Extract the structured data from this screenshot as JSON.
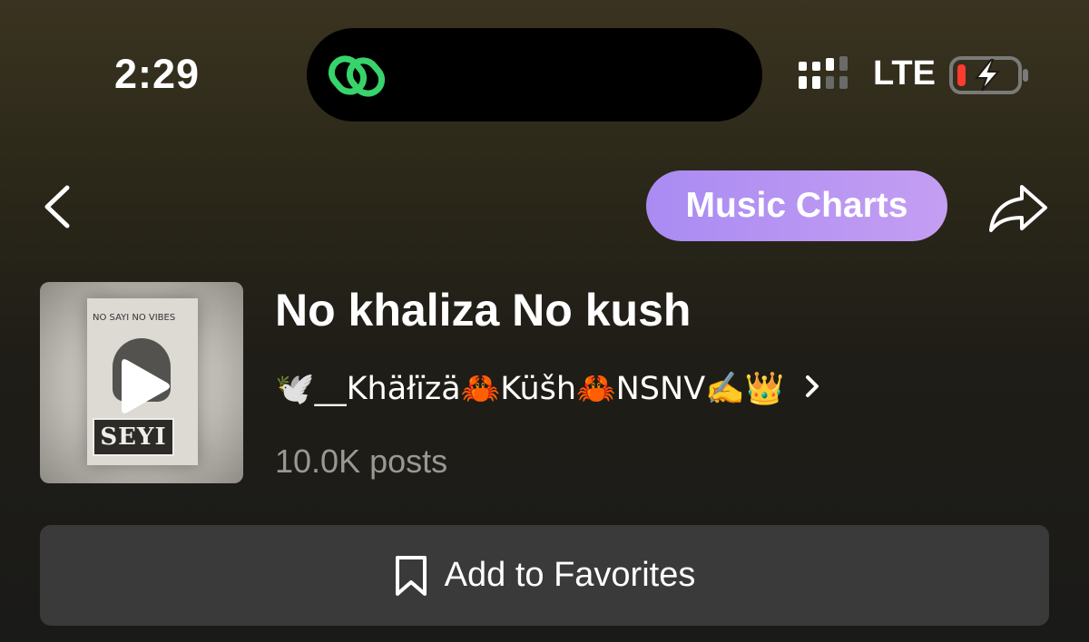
{
  "status_bar": {
    "time": "2:29",
    "network": "LTE"
  },
  "header": {
    "charts_label": "Music Charts"
  },
  "sound": {
    "title": "No khaliza No kush",
    "author": "🕊️__Khäłïzä🦀Küšh🦀NSNV✍️👑",
    "posts": "10.0K posts",
    "cover_text": {
      "poster_title": "NO SAYI NO VIBES",
      "name_tag": "SEYI"
    }
  },
  "actions": {
    "favorites_label": "Add to Favorites"
  },
  "icons": {
    "island": "link-icon",
    "back": "chevron-left-icon",
    "share": "share-arrow-icon",
    "cover_overlay": "play-icon",
    "author_more": "chevron-right-icon",
    "favorites": "bookmark-icon"
  },
  "colors": {
    "link_icon": "#38d36a",
    "charts_pill_start": "#a98bf2",
    "charts_pill_end": "#c49ef2",
    "battery_low": "#ff3b30",
    "muted_text": "#9a9892",
    "button_bg": "#3a3a3a"
  }
}
